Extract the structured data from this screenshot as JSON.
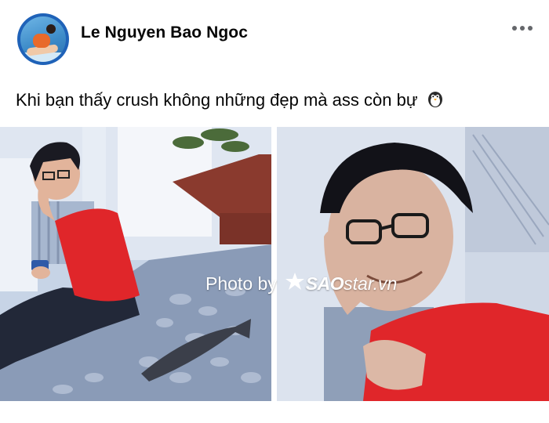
{
  "post": {
    "author": "Le Nguyen Bao Ngoc",
    "text": "Khi bạn thấy crush không những đẹp mà ass còn bự",
    "emoji_icon": "penguin-icon"
  },
  "menu": {
    "icon": "more-horizontal-icon"
  },
  "watermark": {
    "prefix": "Photo by",
    "brand_bold": "SAO",
    "brand_rest": "star.vn"
  },
  "colors": {
    "shirt": "#e0262a",
    "name_text": "#050505",
    "menu_dots": "#65676b",
    "avatar_ring": "#1f62b8"
  }
}
